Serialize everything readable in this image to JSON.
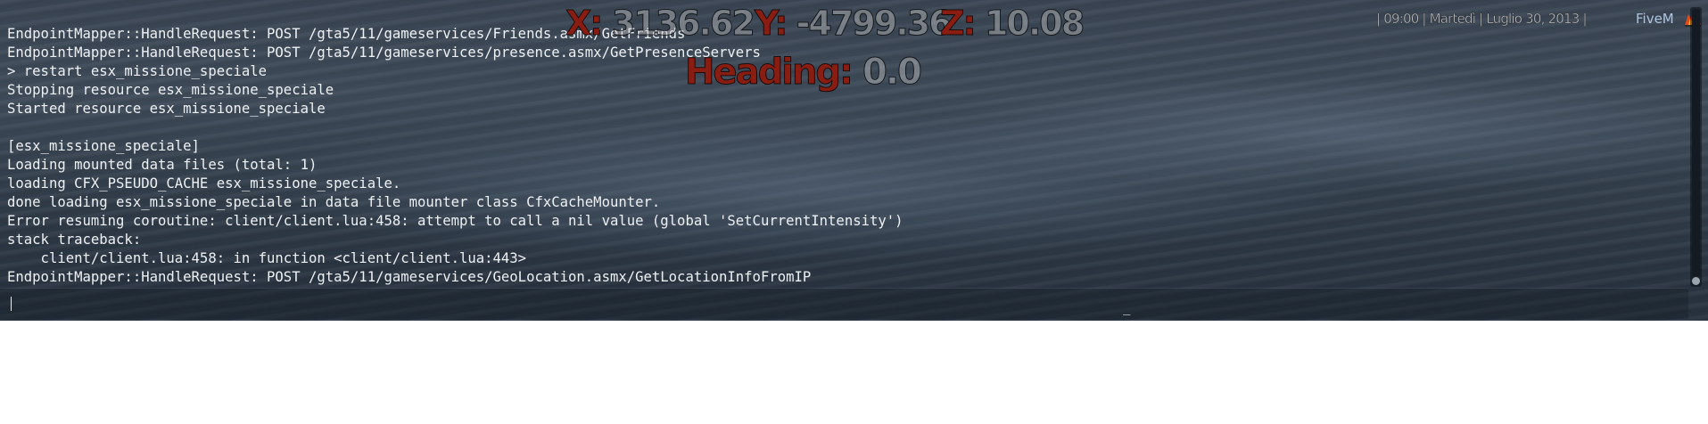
{
  "hud": {
    "x_label": "X:",
    "x_value": "3136.62",
    "y_label": "Y:",
    "y_value": "-4799.36",
    "z_label": "Z:",
    "z_value": "10.08",
    "heading_label": "Heading:",
    "heading_value": "0.0"
  },
  "top_bar": {
    "info": "| 09:00 | Martedì | Luglio 30, 2013 |",
    "brand": "FiveM",
    "brand_icon": "fivem-logo-icon"
  },
  "console": {
    "lines": [
      "EndpointMapper::HandleRequest: POST /gta5/11/gameservices/Friends.asmx/GetFriends",
      "EndpointMapper::HandleRequest: POST /gta5/11/gameservices/presence.asmx/GetPresenceServers",
      "> restart esx_missione_speciale",
      "Stopping resource esx_missione_speciale",
      "Started resource esx_missione_speciale",
      "",
      "[esx_missione_speciale]",
      "Loading mounted data files (total: 1)",
      "loading CFX_PSEUDO_CACHE esx_missione_speciale.",
      "done loading esx_missione_speciale in data file mounter class CfxCacheMounter.",
      "Error resuming coroutine: client/client.lua:458: attempt to call a nil value (global 'SetCurrentIntensity')",
      "stack traceback:",
      "    client/client.lua:458: in function <client/client.lua:443>",
      "EndpointMapper::HandleRequest: POST /gta5/11/gameservices/GeoLocation.asmx/GetLocationInfoFromIP"
    ],
    "input_value": "",
    "input_cursor_glyph": "_"
  },
  "colors": {
    "hud_label": "#8a1d12",
    "console_text": "#eef1f4",
    "brand": "#aec4dc"
  }
}
